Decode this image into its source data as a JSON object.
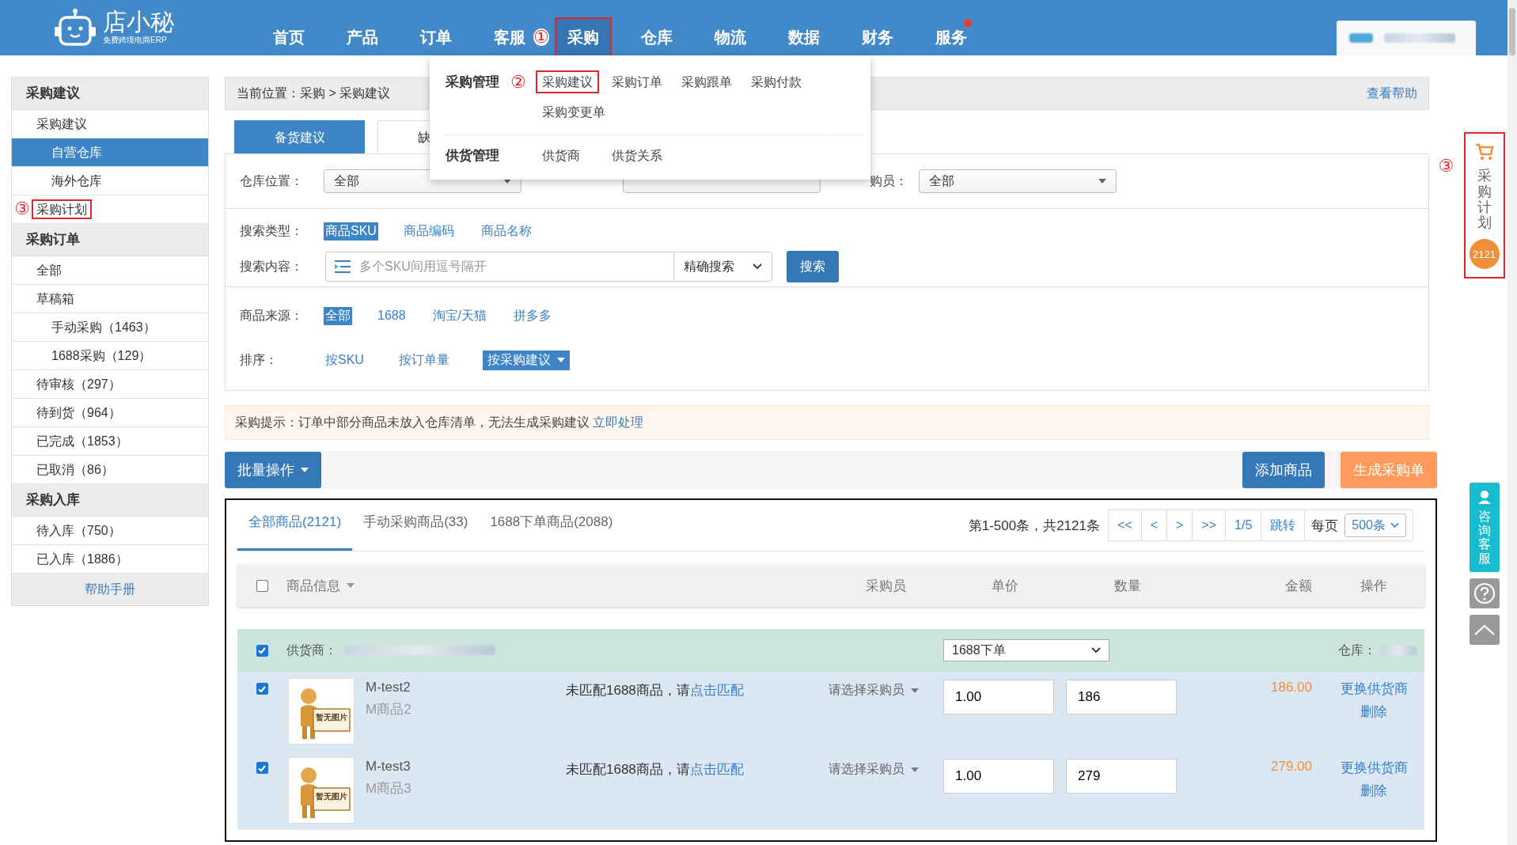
{
  "header": {
    "logo_text": "店小秘",
    "logo_subtitle": "免费跨境电商ERP",
    "nav": [
      {
        "label": "首页",
        "selected": false,
        "dot": false
      },
      {
        "label": "产品",
        "selected": false,
        "dot": false
      },
      {
        "label": "订单",
        "selected": false,
        "dot": false
      },
      {
        "label": "客服",
        "selected": false,
        "dot": false
      },
      {
        "label": "采购",
        "selected": true,
        "dot": false,
        "marker": "①"
      },
      {
        "label": "仓库",
        "selected": false,
        "dot": false
      },
      {
        "label": "物流",
        "selected": false,
        "dot": false
      },
      {
        "label": "数据",
        "selected": false,
        "dot": false
      },
      {
        "label": "财务",
        "selected": false,
        "dot": false
      },
      {
        "label": "服务",
        "selected": false,
        "dot": true
      }
    ]
  },
  "dropdown": {
    "groups": [
      {
        "title": "采购管理",
        "items": [
          {
            "label": "采购建议",
            "marker": "②"
          },
          {
            "label": "采购订单"
          },
          {
            "label": "采购跟单"
          },
          {
            "label": "采购付款"
          },
          {
            "label": "采购变更单"
          }
        ]
      },
      {
        "title": "供货管理",
        "items": [
          {
            "label": "供货商"
          },
          {
            "label": "供货关系"
          }
        ]
      }
    ]
  },
  "sidebar": {
    "sections": [
      {
        "title": "采购建议",
        "items": [
          {
            "label": "采购建议",
            "selected": false,
            "children": [
              {
                "label": "自营仓库",
                "selected": true
              },
              {
                "label": "海外仓库",
                "selected": false
              }
            ]
          },
          {
            "label": "采购计划",
            "selected": false,
            "marker": "③"
          }
        ]
      },
      {
        "title": "采购订单",
        "items": [
          {
            "label": "全部",
            "selected": false
          },
          {
            "label": "草稿箱",
            "selected": false,
            "children": [
              {
                "label": "手动采购（1463）",
                "selected": false
              },
              {
                "label": "1688采购（129）",
                "selected": false
              }
            ]
          },
          {
            "label": "待审核（297）",
            "selected": false
          },
          {
            "label": "待到货（964）",
            "selected": false
          },
          {
            "label": "已完成（1853）",
            "selected": false
          },
          {
            "label": "已取消（86）",
            "selected": false
          }
        ]
      },
      {
        "title": "采购入库",
        "items": [
          {
            "label": "待入库（750）",
            "selected": false
          },
          {
            "label": "已入库（1886）",
            "selected": false
          }
        ]
      }
    ],
    "help": "帮助手册"
  },
  "breadcrumb": {
    "text": "当前位置：采购 > 采购建议",
    "help": "查看帮助"
  },
  "tabs": [
    {
      "label": "备货建议",
      "selected": true
    },
    {
      "label": "缺",
      "selected": false
    }
  ],
  "filters": {
    "warehouse": {
      "label": "仓库位置：",
      "value": "全部"
    },
    "buyer": {
      "label": "购员：",
      "value": "全部"
    },
    "search_type": {
      "label": "搜索类型：",
      "options": [
        {
          "label": "商品SKU",
          "selected": true
        },
        {
          "label": "商品编码",
          "selected": false
        },
        {
          "label": "商品名称",
          "selected": false
        }
      ]
    },
    "search": {
      "label": "搜索内容：",
      "placeholder": "多个SKU间用逗号隔开",
      "mode": "精确搜索",
      "button": "搜索"
    },
    "source": {
      "label": "商品来源：",
      "options": [
        {
          "label": "全部",
          "selected": true
        },
        {
          "label": "1688",
          "selected": false
        },
        {
          "label": "淘宝/天猫",
          "selected": false
        },
        {
          "label": "拼多多",
          "selected": false
        }
      ]
    },
    "sort": {
      "label": "排序：",
      "options": [
        {
          "label": "按SKU",
          "selected": false
        },
        {
          "label": "按订单量",
          "selected": false
        },
        {
          "label": "按采购建议",
          "selected": true
        }
      ]
    }
  },
  "tip": {
    "text": "采购提示：订单中部分商品未放入仓库清单，无法生成采购建议",
    "link": "立即处理"
  },
  "actions": {
    "batch": "批量操作",
    "add": "添加商品",
    "generate": "生成采购单"
  },
  "table": {
    "tabs": [
      {
        "label": "全部商品(2121)",
        "selected": true
      },
      {
        "label": "手动采购商品(33)",
        "selected": false
      },
      {
        "label": "1688下单商品(2088)",
        "selected": false
      }
    ],
    "pager": {
      "summary": "第1-500条，共2121条",
      "buttons": [
        "<<",
        "<",
        ">",
        ">>",
        "1/5",
        "跳转"
      ],
      "per_page_label": "每页",
      "per_page": "500条"
    },
    "header_checked": false,
    "columns": [
      "商品信息",
      "采购员",
      "单价",
      "数量",
      "金额",
      "操作"
    ],
    "group": {
      "checked": true,
      "supplier_label": "供货商：",
      "order_type": "1688下单",
      "warehouse_label": "仓库："
    },
    "rows": [
      {
        "checked": true,
        "sku": "M-test2",
        "name": "M商品2",
        "image_text": "暂无图片",
        "notice": "未匹配1688商品，请",
        "notice_link": "点击匹配",
        "buyer": "请选择采购员",
        "price": "1.00",
        "qty": "186",
        "amount": "186.00",
        "actions": [
          "更换供货商",
          "删除"
        ]
      },
      {
        "checked": true,
        "sku": "M-test3",
        "name": "M商品3",
        "image_text": "暂无图片",
        "notice": "未匹配1688商品，请",
        "notice_link": "点击匹配",
        "buyer": "请选择采购员",
        "price": "1.00",
        "qty": "279",
        "amount": "279.00",
        "actions": [
          "更换供货商",
          "删除"
        ]
      }
    ]
  },
  "rail": {
    "plan": {
      "label": "采购计划",
      "count": "2121",
      "marker": "③"
    },
    "service": "咨询客服"
  }
}
